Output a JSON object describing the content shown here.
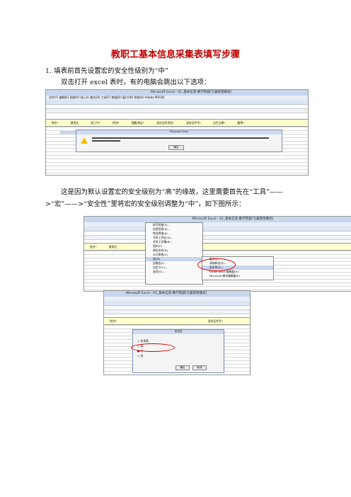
{
  "title": "教职工基本信息采集表填写步骤",
  "step1": "1.  填表前首先设置宏的安全性级别为“中”",
  "para1": "双击打开 excel 表时，有的电脑会跳出以下选项：",
  "para2": "这是因为默认设置宏的安全级别为“高”的缘故，这里需要首先在“工具”——>“宏”——>“安全性”里将宏的安全级别调整为“中”，如下图所示：",
  "shot1": {
    "window_title": "Microsoft Excel - 01_基本信息-数学院部门[兼容性模式]",
    "menu": "文件(F)  编辑(E)  视图(V)  插入(I)  格式(O)  工具(T)  数据(D)  窗口(W)  帮助(H)  Adobe PDF(B)",
    "columns": [
      "姓名*",
      "曾用名",
      "职工号*",
      "性别*",
      "国籍/地区*",
      "身份证件类型*",
      "身份证件号*",
      "出生日期*",
      "籍贯*"
    ],
    "dialog_title": "Microsoft Excel",
    "ok": "确定"
  },
  "shot2": {
    "window_title": "Microsoft Excel - 01_基本信息-数学院部门[兼容性模式]",
    "menu_items": [
      "拼写检查(S)...",
      "信息检索(R)...",
      "错误检查(K)...",
      "共享工作区(D)...",
      "共享工作簿(B)...",
      "保护(P)",
      "联机协作(N)",
      "公式审核(U)",
      "宏(M)",
      "加载宏(I)...",
      "自定义(C)...",
      "选项(O)..."
    ],
    "submenu": [
      "宏(M)...",
      "录制新宏(R)...",
      "安全性(S)...",
      "Visual Basic 编辑器(V)",
      "Microsoft 脚本编辑器(E)"
    ],
    "columns": [
      "姓名*",
      "曾用名"
    ]
  },
  "shot3": {
    "window_title": "Microsoft Excel - 01_基本信息-数学院部门[兼容性模式]",
    "dialog_title": "安全性",
    "options": [
      "非常高",
      "高",
      "中",
      "低"
    ],
    "ok": "确定",
    "cancel": "取消",
    "columns": [
      "性别*",
      "身份证件号*"
    ]
  }
}
